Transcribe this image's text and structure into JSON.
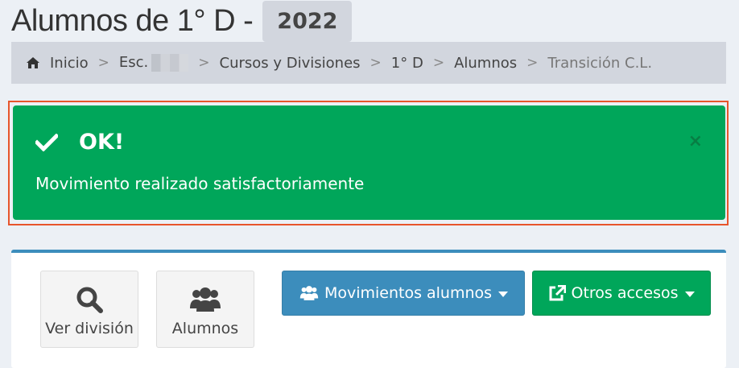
{
  "header": {
    "title": "Alumnos de 1° D -",
    "year": "2022"
  },
  "breadcrumb": {
    "items": [
      {
        "label": "Inicio",
        "icon": "home-icon"
      },
      {
        "label": "Esc."
      },
      {
        "label": "Cursos y Divisiones"
      },
      {
        "label": "1° D"
      },
      {
        "label": "Alumnos"
      },
      {
        "label": "Transición C.L."
      }
    ],
    "separator": ">"
  },
  "alert": {
    "title": "OK!",
    "message": "Movimiento realizado satisfactoriamente",
    "close_label": "×",
    "color": "#00a65a"
  },
  "actions": {
    "ver_division": "Ver división",
    "alumnos": "Alumnos",
    "movimientos": "Movimientos alumnos",
    "otros_accesos": "Otros accesos"
  },
  "colors": {
    "primary": "#3c8dbc",
    "success": "#00a65a",
    "breadcrumb_bg": "#d2d6de",
    "highlight": "#e7552c"
  }
}
